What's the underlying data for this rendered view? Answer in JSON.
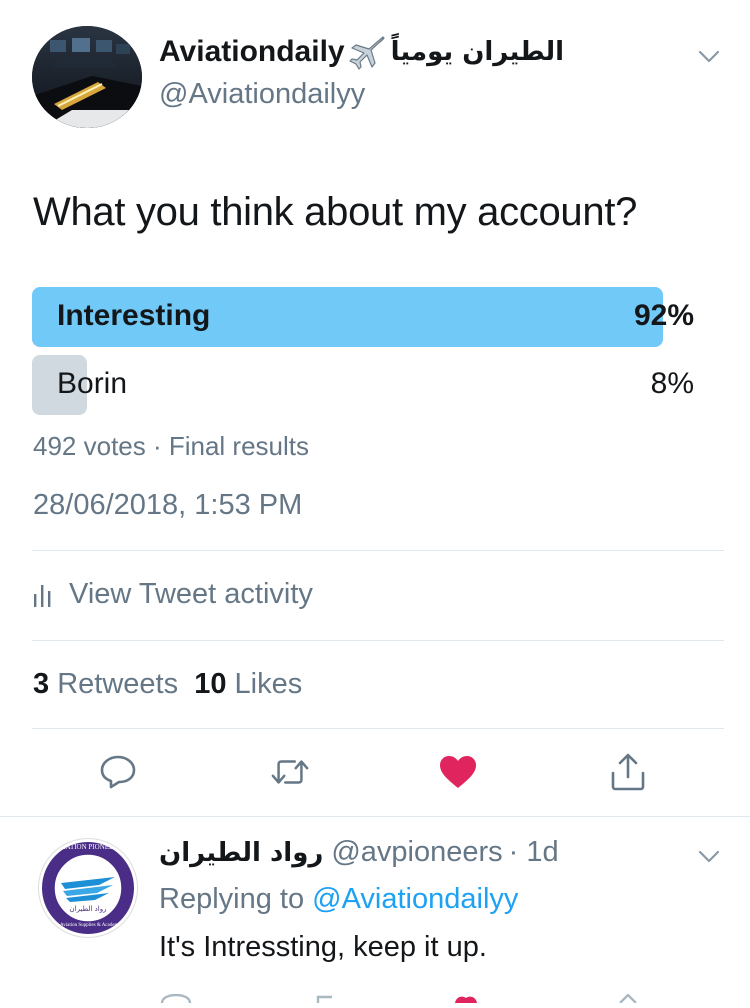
{
  "tweet": {
    "author": {
      "display_name": "Aviationdaily",
      "emoji_icon": "airplane-icon",
      "arabic_name": "الطيران يومياً",
      "handle": "@Aviationdailyy"
    },
    "question": "What you think about my account?",
    "poll": {
      "options": [
        {
          "label": "Interesting",
          "percent_text": "92%",
          "percent": 92,
          "winner": true,
          "color": "#71c9f8"
        },
        {
          "label": "Borin",
          "percent_text": "8%",
          "percent": 8,
          "winner": false,
          "color": "#d0d9df"
        }
      ],
      "meta": "492 votes · Final results"
    },
    "timestamp": "28/06/2018, 1:53 PM",
    "activity_label": "View Tweet activity",
    "stats": {
      "retweets_count": "3",
      "retweets_label": "Retweets",
      "likes_count": "10",
      "likes_label": "Likes"
    },
    "actions": [
      {
        "icon": "reply-icon"
      },
      {
        "icon": "retweet-icon"
      },
      {
        "icon": "heart-icon",
        "active": true,
        "color": "#e0245e"
      },
      {
        "icon": "share-icon"
      }
    ]
  },
  "reply": {
    "name": "رواد الطيران",
    "handle": "@avpioneers",
    "time": "· 1d",
    "replying_prefix": "Replying to",
    "replying_to": "@Aviationdailyy",
    "text": "It's Intressting, keep it up.",
    "avatar_text_top": "AVIATION PIONEERS",
    "avatar_text_center": "رواد الطيران",
    "avatar_text_bottom": "For Aviation Supplies & Academics"
  },
  "colors": {
    "link": "#1da1f2",
    "muted": "#657786",
    "text": "#14171a",
    "like": "#e0245e"
  }
}
